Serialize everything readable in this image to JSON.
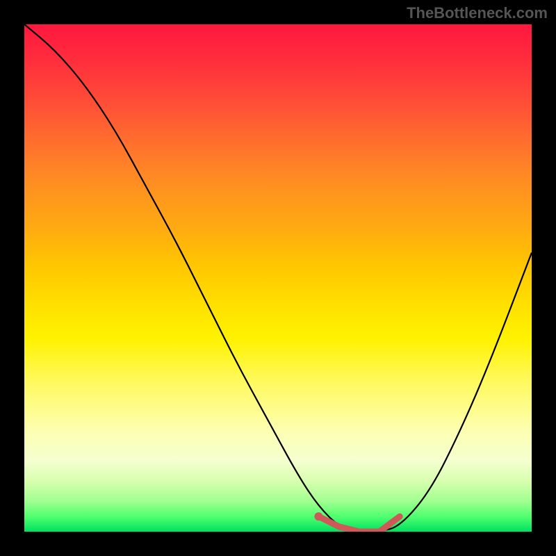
{
  "watermark": "TheBottleneck.com",
  "chart_data": {
    "type": "line",
    "title": "",
    "xlabel": "",
    "ylabel": "",
    "xlim": [
      0,
      100
    ],
    "ylim": [
      0,
      100
    ],
    "grid": false,
    "legend": false,
    "gradient_stops": [
      {
        "pos": 0,
        "color": "#ff173f"
      },
      {
        "pos": 14,
        "color": "#ff4838"
      },
      {
        "pos": 30,
        "color": "#ff8a24"
      },
      {
        "pos": 48,
        "color": "#ffc800"
      },
      {
        "pos": 62,
        "color": "#fff200"
      },
      {
        "pos": 80,
        "color": "#fdffb0"
      },
      {
        "pos": 94,
        "color": "#a0ff90"
      },
      {
        "pos": 100,
        "color": "#00e060"
      }
    ],
    "series": [
      {
        "name": "bottleneck-curve",
        "color": "#000000",
        "x": [
          0,
          6,
          12,
          18,
          24,
          30,
          36,
          42,
          48,
          54,
          58,
          62,
          66,
          70,
          74,
          80,
          86,
          92,
          100
        ],
        "y": [
          100,
          95,
          88,
          79,
          68,
          57,
          45,
          33,
          22,
          11,
          5,
          1,
          0,
          0,
          1,
          8,
          20,
          34,
          55
        ]
      },
      {
        "name": "optimal-range-marker",
        "color": "#d05a5a",
        "x": [
          58,
          62,
          66,
          70,
          74
        ],
        "y": [
          3,
          1,
          0,
          0,
          3
        ]
      }
    ],
    "annotations": [
      {
        "name": "curve-minimum-dot",
        "x": 58,
        "y": 3,
        "color": "#d05a5a"
      }
    ]
  }
}
